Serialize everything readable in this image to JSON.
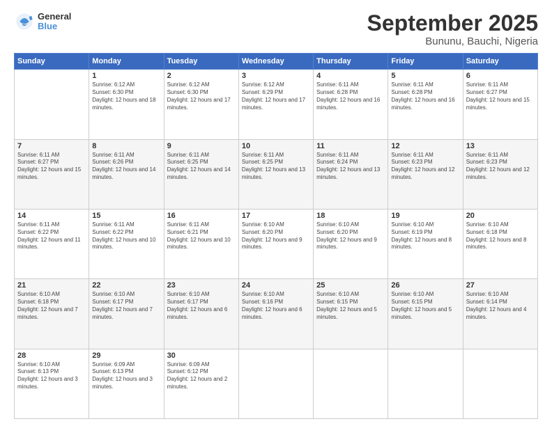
{
  "header": {
    "logo_general": "General",
    "logo_blue": "Blue",
    "title": "September 2025",
    "subtitle": "Bununu, Bauchi, Nigeria"
  },
  "days_of_week": [
    "Sunday",
    "Monday",
    "Tuesday",
    "Wednesday",
    "Thursday",
    "Friday",
    "Saturday"
  ],
  "weeks": [
    [
      {
        "day": "",
        "sunrise": "",
        "sunset": "",
        "daylight": ""
      },
      {
        "day": "1",
        "sunrise": "Sunrise: 6:12 AM",
        "sunset": "Sunset: 6:30 PM",
        "daylight": "Daylight: 12 hours and 18 minutes."
      },
      {
        "day": "2",
        "sunrise": "Sunrise: 6:12 AM",
        "sunset": "Sunset: 6:30 PM",
        "daylight": "Daylight: 12 hours and 17 minutes."
      },
      {
        "day": "3",
        "sunrise": "Sunrise: 6:12 AM",
        "sunset": "Sunset: 6:29 PM",
        "daylight": "Daylight: 12 hours and 17 minutes."
      },
      {
        "day": "4",
        "sunrise": "Sunrise: 6:11 AM",
        "sunset": "Sunset: 6:28 PM",
        "daylight": "Daylight: 12 hours and 16 minutes."
      },
      {
        "day": "5",
        "sunrise": "Sunrise: 6:11 AM",
        "sunset": "Sunset: 6:28 PM",
        "daylight": "Daylight: 12 hours and 16 minutes."
      },
      {
        "day": "6",
        "sunrise": "Sunrise: 6:11 AM",
        "sunset": "Sunset: 6:27 PM",
        "daylight": "Daylight: 12 hours and 15 minutes."
      }
    ],
    [
      {
        "day": "7",
        "sunrise": "Sunrise: 6:11 AM",
        "sunset": "Sunset: 6:27 PM",
        "daylight": "Daylight: 12 hours and 15 minutes."
      },
      {
        "day": "8",
        "sunrise": "Sunrise: 6:11 AM",
        "sunset": "Sunset: 6:26 PM",
        "daylight": "Daylight: 12 hours and 14 minutes."
      },
      {
        "day": "9",
        "sunrise": "Sunrise: 6:11 AM",
        "sunset": "Sunset: 6:25 PM",
        "daylight": "Daylight: 12 hours and 14 minutes."
      },
      {
        "day": "10",
        "sunrise": "Sunrise: 6:11 AM",
        "sunset": "Sunset: 6:25 PM",
        "daylight": "Daylight: 12 hours and 13 minutes."
      },
      {
        "day": "11",
        "sunrise": "Sunrise: 6:11 AM",
        "sunset": "Sunset: 6:24 PM",
        "daylight": "Daylight: 12 hours and 13 minutes."
      },
      {
        "day": "12",
        "sunrise": "Sunrise: 6:11 AM",
        "sunset": "Sunset: 6:23 PM",
        "daylight": "Daylight: 12 hours and 12 minutes."
      },
      {
        "day": "13",
        "sunrise": "Sunrise: 6:11 AM",
        "sunset": "Sunset: 6:23 PM",
        "daylight": "Daylight: 12 hours and 12 minutes."
      }
    ],
    [
      {
        "day": "14",
        "sunrise": "Sunrise: 6:11 AM",
        "sunset": "Sunset: 6:22 PM",
        "daylight": "Daylight: 12 hours and 11 minutes."
      },
      {
        "day": "15",
        "sunrise": "Sunrise: 6:11 AM",
        "sunset": "Sunset: 6:22 PM",
        "daylight": "Daylight: 12 hours and 10 minutes."
      },
      {
        "day": "16",
        "sunrise": "Sunrise: 6:11 AM",
        "sunset": "Sunset: 6:21 PM",
        "daylight": "Daylight: 12 hours and 10 minutes."
      },
      {
        "day": "17",
        "sunrise": "Sunrise: 6:10 AM",
        "sunset": "Sunset: 6:20 PM",
        "daylight": "Daylight: 12 hours and 9 minutes."
      },
      {
        "day": "18",
        "sunrise": "Sunrise: 6:10 AM",
        "sunset": "Sunset: 6:20 PM",
        "daylight": "Daylight: 12 hours and 9 minutes."
      },
      {
        "day": "19",
        "sunrise": "Sunrise: 6:10 AM",
        "sunset": "Sunset: 6:19 PM",
        "daylight": "Daylight: 12 hours and 8 minutes."
      },
      {
        "day": "20",
        "sunrise": "Sunrise: 6:10 AM",
        "sunset": "Sunset: 6:18 PM",
        "daylight": "Daylight: 12 hours and 8 minutes."
      }
    ],
    [
      {
        "day": "21",
        "sunrise": "Sunrise: 6:10 AM",
        "sunset": "Sunset: 6:18 PM",
        "daylight": "Daylight: 12 hours and 7 minutes."
      },
      {
        "day": "22",
        "sunrise": "Sunrise: 6:10 AM",
        "sunset": "Sunset: 6:17 PM",
        "daylight": "Daylight: 12 hours and 7 minutes."
      },
      {
        "day": "23",
        "sunrise": "Sunrise: 6:10 AM",
        "sunset": "Sunset: 6:17 PM",
        "daylight": "Daylight: 12 hours and 6 minutes."
      },
      {
        "day": "24",
        "sunrise": "Sunrise: 6:10 AM",
        "sunset": "Sunset: 6:16 PM",
        "daylight": "Daylight: 12 hours and 6 minutes."
      },
      {
        "day": "25",
        "sunrise": "Sunrise: 6:10 AM",
        "sunset": "Sunset: 6:15 PM",
        "daylight": "Daylight: 12 hours and 5 minutes."
      },
      {
        "day": "26",
        "sunrise": "Sunrise: 6:10 AM",
        "sunset": "Sunset: 6:15 PM",
        "daylight": "Daylight: 12 hours and 5 minutes."
      },
      {
        "day": "27",
        "sunrise": "Sunrise: 6:10 AM",
        "sunset": "Sunset: 6:14 PM",
        "daylight": "Daylight: 12 hours and 4 minutes."
      }
    ],
    [
      {
        "day": "28",
        "sunrise": "Sunrise: 6:10 AM",
        "sunset": "Sunset: 6:13 PM",
        "daylight": "Daylight: 12 hours and 3 minutes."
      },
      {
        "day": "29",
        "sunrise": "Sunrise: 6:09 AM",
        "sunset": "Sunset: 6:13 PM",
        "daylight": "Daylight: 12 hours and 3 minutes."
      },
      {
        "day": "30",
        "sunrise": "Sunrise: 6:09 AM",
        "sunset": "Sunset: 6:12 PM",
        "daylight": "Daylight: 12 hours and 2 minutes."
      },
      {
        "day": "",
        "sunrise": "",
        "sunset": "",
        "daylight": ""
      },
      {
        "day": "",
        "sunrise": "",
        "sunset": "",
        "daylight": ""
      },
      {
        "day": "",
        "sunrise": "",
        "sunset": "",
        "daylight": ""
      },
      {
        "day": "",
        "sunrise": "",
        "sunset": "",
        "daylight": ""
      }
    ]
  ]
}
